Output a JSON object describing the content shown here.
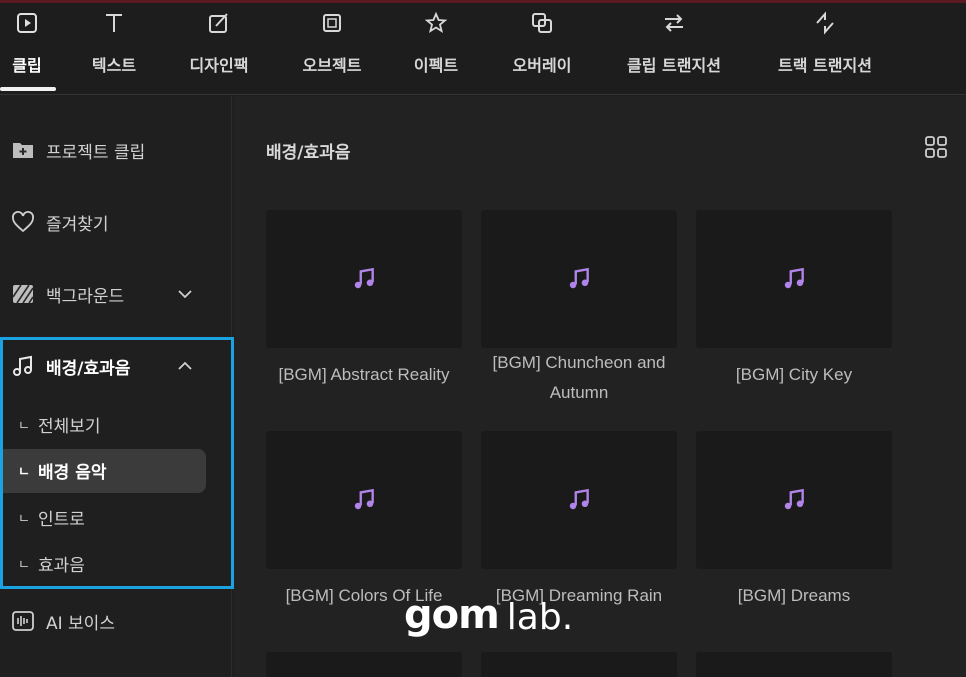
{
  "toolbar": {
    "tabs": [
      {
        "label": "클립",
        "icon": "play-clip-icon",
        "active": true
      },
      {
        "label": "텍스트",
        "icon": "text-icon"
      },
      {
        "label": "디자인팩",
        "icon": "design-pack-icon"
      },
      {
        "label": "오브젝트",
        "icon": "object-icon"
      },
      {
        "label": "이펙트",
        "icon": "effect-star-icon"
      },
      {
        "label": "오버레이",
        "icon": "overlay-icon"
      },
      {
        "label": "클립 트랜지션",
        "icon": "clip-transition-icon"
      },
      {
        "label": "트랙 트랜지션",
        "icon": "track-transition-icon"
      }
    ]
  },
  "sidebar": {
    "items": [
      {
        "label": "프로젝트 클립",
        "icon": "project-folder-icon"
      },
      {
        "label": "즐겨찾기",
        "icon": "heart-icon"
      },
      {
        "label": "백그라운드",
        "icon": "background-pattern-icon",
        "chevron": "down"
      },
      {
        "label": "배경/효과음",
        "icon": "music-note-icon",
        "chevron": "up"
      },
      {
        "label": "AI 보이스",
        "icon": "ai-voice-icon"
      }
    ],
    "subitems": [
      {
        "bullet": "ㄴ",
        "label": "전체보기"
      },
      {
        "bullet": "ㄴ",
        "label": "배경 음악",
        "selected": true
      },
      {
        "bullet": "ㄴ",
        "label": "인트로"
      },
      {
        "bullet": "ㄴ",
        "label": "효과음"
      }
    ]
  },
  "main": {
    "title": "배경/효과음",
    "cards": [
      {
        "title": "[BGM] Abstract Reality"
      },
      {
        "title": "[BGM] Chuncheon and Autumn"
      },
      {
        "title": "[BGM] City Key"
      },
      {
        "title": "[BGM] Colors Of Life"
      },
      {
        "title": "[BGM] Dreaming Rain"
      },
      {
        "title": "[BGM] Dreams"
      }
    ]
  },
  "watermark": {
    "part1": "gom",
    "part2": "lab."
  },
  "colors": {
    "accent_highlight": "#1aa3e0",
    "note_purple": "#b084e8",
    "background": "#1f1f1f"
  }
}
